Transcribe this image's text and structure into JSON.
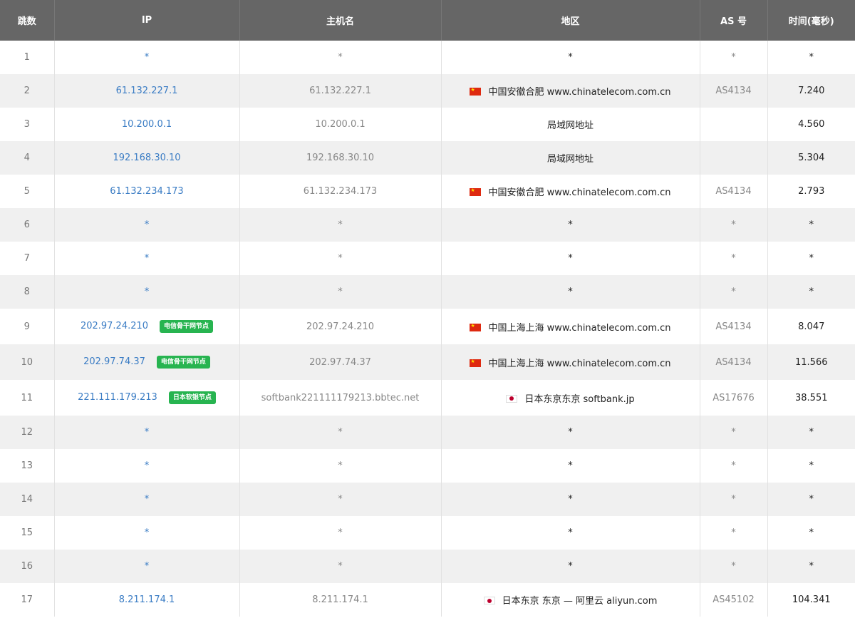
{
  "headers": {
    "hop": "跳数",
    "ip": "IP",
    "hostname": "主机名",
    "region": "地区",
    "as": "AS 号",
    "time": "时间(毫秒)"
  },
  "rows": [
    {
      "hop": "1",
      "ip": "*",
      "badge": "",
      "hostname": "*",
      "flag": "",
      "region": "*",
      "as": "*",
      "time": "*"
    },
    {
      "hop": "2",
      "ip": "61.132.227.1",
      "badge": "",
      "hostname": "61.132.227.1",
      "flag": "cn",
      "region": "中国安徽合肥 www.chinatelecom.com.cn",
      "as": "AS4134",
      "time": "7.240"
    },
    {
      "hop": "3",
      "ip": "10.200.0.1",
      "badge": "",
      "hostname": "10.200.0.1",
      "flag": "",
      "region": "局域网地址",
      "as": "",
      "time": "4.560"
    },
    {
      "hop": "4",
      "ip": "192.168.30.10",
      "badge": "",
      "hostname": "192.168.30.10",
      "flag": "",
      "region": "局域网地址",
      "as": "",
      "time": "5.304"
    },
    {
      "hop": "5",
      "ip": "61.132.234.173",
      "badge": "",
      "hostname": "61.132.234.173",
      "flag": "cn",
      "region": "中国安徽合肥 www.chinatelecom.com.cn",
      "as": "AS4134",
      "time": "2.793"
    },
    {
      "hop": "6",
      "ip": "*",
      "badge": "",
      "hostname": "*",
      "flag": "",
      "region": "*",
      "as": "*",
      "time": "*"
    },
    {
      "hop": "7",
      "ip": "*",
      "badge": "",
      "hostname": "*",
      "flag": "",
      "region": "*",
      "as": "*",
      "time": "*"
    },
    {
      "hop": "8",
      "ip": "*",
      "badge": "",
      "hostname": "*",
      "flag": "",
      "region": "*",
      "as": "*",
      "time": "*"
    },
    {
      "hop": "9",
      "ip": "202.97.24.210",
      "badge": "电信骨干网节点",
      "hostname": "202.97.24.210",
      "flag": "cn",
      "region": "中国上海上海 www.chinatelecom.com.cn",
      "as": "AS4134",
      "time": "8.047"
    },
    {
      "hop": "10",
      "ip": "202.97.74.37",
      "badge": "电信骨干网节点",
      "hostname": "202.97.74.37",
      "flag": "cn",
      "region": "中国上海上海 www.chinatelecom.com.cn",
      "as": "AS4134",
      "time": "11.566"
    },
    {
      "hop": "11",
      "ip": "221.111.179.213",
      "badge": "日本软银节点",
      "hostname": "softbank221111179213.bbtec.net",
      "flag": "jp",
      "region": "日本东京东京 softbank.jp",
      "as": "AS17676",
      "time": "38.551"
    },
    {
      "hop": "12",
      "ip": "*",
      "badge": "",
      "hostname": "*",
      "flag": "",
      "region": "*",
      "as": "*",
      "time": "*"
    },
    {
      "hop": "13",
      "ip": "*",
      "badge": "",
      "hostname": "*",
      "flag": "",
      "region": "*",
      "as": "*",
      "time": "*"
    },
    {
      "hop": "14",
      "ip": "*",
      "badge": "",
      "hostname": "*",
      "flag": "",
      "region": "*",
      "as": "*",
      "time": "*"
    },
    {
      "hop": "15",
      "ip": "*",
      "badge": "",
      "hostname": "*",
      "flag": "",
      "region": "*",
      "as": "*",
      "time": "*"
    },
    {
      "hop": "16",
      "ip": "*",
      "badge": "",
      "hostname": "*",
      "flag": "",
      "region": "*",
      "as": "*",
      "time": "*"
    },
    {
      "hop": "17",
      "ip": "8.211.174.1",
      "badge": "",
      "hostname": "8.211.174.1",
      "flag": "jp",
      "region": "日本东京 东京 — 阿里云 aliyun.com",
      "as": "AS45102",
      "time": "104.341"
    }
  ]
}
